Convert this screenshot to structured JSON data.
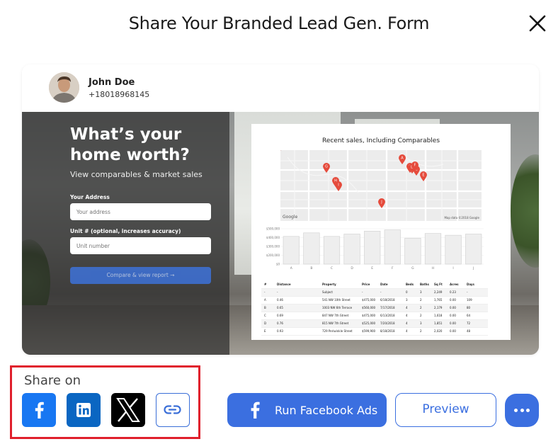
{
  "modal": {
    "title": "Share Your Branded Lead Gen. Form"
  },
  "agent": {
    "name": "John Doe",
    "phone": "+18018968145"
  },
  "form": {
    "heading": "What’s your home worth?",
    "subheading": "View comparables & market sales",
    "address_label": "Your Address",
    "address_placeholder": "Your address",
    "unit_label": "Unit # (optional, increases accuracy)",
    "unit_placeholder": "Unit number",
    "submit_label": "Compare & view report →"
  },
  "report": {
    "title": "Recent sales, Including Comparables",
    "map_attribution": "Google",
    "map_data": "Map data ©2018 Google",
    "map_pins": [
      "A",
      "B",
      "C",
      "D",
      "E",
      "F",
      "G",
      "H",
      "I",
      "J"
    ],
    "chart_y_ticks": [
      "$500,000",
      "$400,000",
      "$300,000",
      "$200,000",
      "$0"
    ],
    "chart_x_ticks": [
      "A",
      "B",
      "C",
      "D",
      "E",
      "F",
      "G",
      "H",
      "I",
      "J"
    ],
    "chart_values": [
      470000,
      530000,
      470000,
      510000,
      560000,
      580000,
      440000,
      520000,
      490000,
      510000
    ],
    "table_headers": [
      "#",
      "Distance",
      "Property",
      "Price",
      "Date",
      "Beds",
      "Baths",
      "Sq Ft",
      "Acres",
      "Days"
    ],
    "table_rows": [
      [
        "-",
        "-",
        "Subject",
        "-",
        "-",
        "0",
        "3",
        "2,249",
        "0.23",
        "-"
      ],
      [
        "A",
        "0.46",
        "541 NW 10th Street",
        "$475,000",
        "6/18/2018",
        "3",
        "2",
        "1,765",
        "0.00",
        "109"
      ],
      [
        "B",
        "0.65",
        "1003 NW 6th Terrace",
        "$560,000",
        "7/17/2018",
        "4",
        "2",
        "2,179",
        "0.00",
        "80"
      ],
      [
        "C",
        "0.69",
        "847 NW 7th Street",
        "$475,000",
        "6/13/2018",
        "4",
        "2",
        "1,618",
        "0.00",
        "64"
      ],
      [
        "D",
        "0.76",
        "815 NW 7th Street",
        "$525,000",
        "7/20/2018",
        "4",
        "3",
        "1,851",
        "0.00",
        "72"
      ],
      [
        "E",
        "0.93",
        "729 Periwinkle Street",
        "$599,900",
        "8/18/2018",
        "4",
        "2",
        "2,020",
        "0.00",
        "48"
      ]
    ]
  },
  "share": {
    "label": "Share on",
    "networks": [
      "facebook-icon",
      "linkedin-icon",
      "x-icon",
      "link-icon"
    ]
  },
  "actions": {
    "run_ads_label": "Run Facebook Ads",
    "preview_label": "Preview"
  },
  "colors": {
    "accent": "#3b6fe0",
    "facebook": "#1877f2",
    "linkedin": "#0a66c2",
    "x": "#000000",
    "highlight_border": "#e0202c"
  }
}
